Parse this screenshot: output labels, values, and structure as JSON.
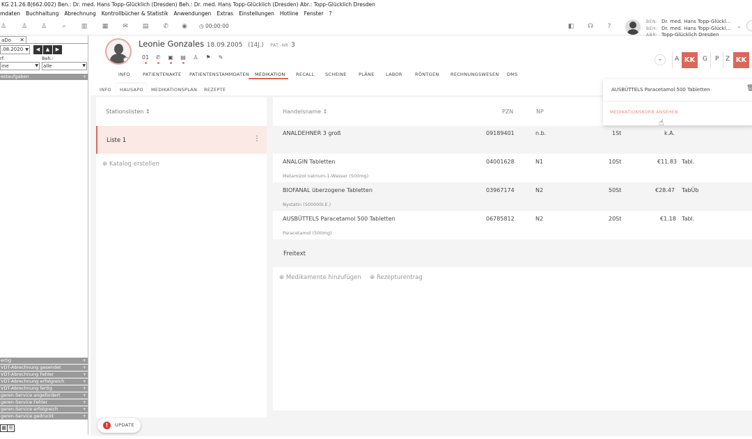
{
  "titlebar": "KG 21.26.8(662.002)   Ben.: Dr. med. Hans Topp-Glücklich (Dresden)   Beh.: Dr. med. Hans Topp-Glücklich (Dresden)   Abr.: Topp-Glücklich Dresden",
  "menu": [
    "mdaten",
    "Buchhaltung",
    "Abrechnung",
    "Kontrollbücher & Statistik",
    "Anwendungen",
    "Extras",
    "Einstellungen",
    "Hotline",
    "Fenster",
    "?"
  ],
  "toolbar": {
    "timer": "00:00:00",
    "icons": [
      "person-icon",
      "person-group-icon",
      "person-tree-icon",
      "search-icon",
      "chart-icon",
      "calendar-icon",
      "mail-icon",
      "printer-icon",
      "phone-icon",
      "eye-icon"
    ]
  },
  "user": {
    "ben_key": "BEN:",
    "ben": "Dr. med. Hans Topp-Glückl...",
    "beh_key": "BEH:",
    "beh": "Dr. med. Hans Topp-Glückl...",
    "abr_key": "ABR:",
    "abr": "Topp-Glücklich Dresden"
  },
  "left": {
    "tab": "aDo",
    "tab_close": "✕",
    "date": ".08.2020",
    "prev_year": "◀",
    "up": "▲",
    "next": "▶",
    "label_left": "rf:",
    "label_right": "Beh.:",
    "select_left": "ine",
    "select_right": "alle",
    "group_top": "estaufgaben",
    "groups": [
      "ertig",
      "VDT-Abrechnung gesendet",
      "VDT-Abrechnung Fehler",
      "VDT-Abrechnung erfolgreich",
      "VDT-Abrechnung fertig",
      "geren-Service angefordert",
      "geren-Service Fehler",
      "geren-Service erfolgreich",
      "geren-Service gedruckt"
    ],
    "plus": "+"
  },
  "patient": {
    "name": "Leonie Gonzales",
    "dob": "18.09.2005",
    "age": "(14J.)",
    "nr_key": "PAT.-NR",
    "nr": "3",
    "tool_num": "01"
  },
  "right_letters": {
    "pin": "⌖",
    "a": "A",
    "kk1": "KK",
    "g": "G",
    "p": "P",
    "z": "Z",
    "kk2": "KK"
  },
  "main_tabs": [
    "INFO",
    "PATIENTENAKTE",
    "PATIENTENSTAMMDATEN",
    "MEDIKATION",
    "RECALL",
    "SCHEINE",
    "PLÄNE",
    "LABOR",
    "RÖNTGEN",
    "RECHNUNGSWESEN",
    "DMS"
  ],
  "sub_tabs": [
    "INFO",
    "HAUSAPO",
    "MEDIKATIONSPLAN",
    "REZEPTE"
  ],
  "station": {
    "header": "Stationslisten",
    "sort_icon": "↕",
    "item": "Liste 1",
    "kebab": "⋮",
    "catalog": "⊕  Katalog erstellen"
  },
  "table": {
    "headers": {
      "name": "Handelsname",
      "sort": "↕",
      "pzn": "PZN",
      "np": "NP"
    },
    "rows": [
      {
        "name": "ANALDEHNER 3 groß",
        "sub": "",
        "pzn": "09189401",
        "np": "n.b.",
        "qty": "1St",
        "price": "k.A.",
        "form": ""
      },
      {
        "name": "ANALGIN Tabletten",
        "sub": "Metamizol natrium-1-Wasser (500mg)",
        "pzn": "04001628",
        "np": "N1",
        "qty": "10St",
        "price": "€11.83",
        "form": "Tabl."
      },
      {
        "name": "BIOFANAL überzogene Tabletten",
        "sub": "Nystatin (500000I.E.)",
        "pzn": "03967174",
        "np": "N2",
        "qty": "50St",
        "price": "€28.47",
        "form": "TabÜb"
      },
      {
        "name": "AUSBÜTTELS Paracetamol 500 Tabletten",
        "sub": "Paracetamol (500mg)",
        "pzn": "06785812",
        "np": "N2",
        "qty": "20St",
        "price": "€1.18",
        "form": "Tabl."
      }
    ],
    "freitext": "Freitext",
    "add_med": "⊕  Medikamente hinzufügen",
    "rezeptur": "⊕  Rezepturentrag"
  },
  "popup": {
    "item": "AUSBÜTTELS Paracetamol 500 Tabletten",
    "link": "MEDIKATIONSKORB ANSEHEN"
  },
  "update": {
    "icon": "!",
    "label": "UPDATE"
  },
  "colors": {
    "accent": "#d9675a",
    "accent_light": "#fbe9e5"
  }
}
